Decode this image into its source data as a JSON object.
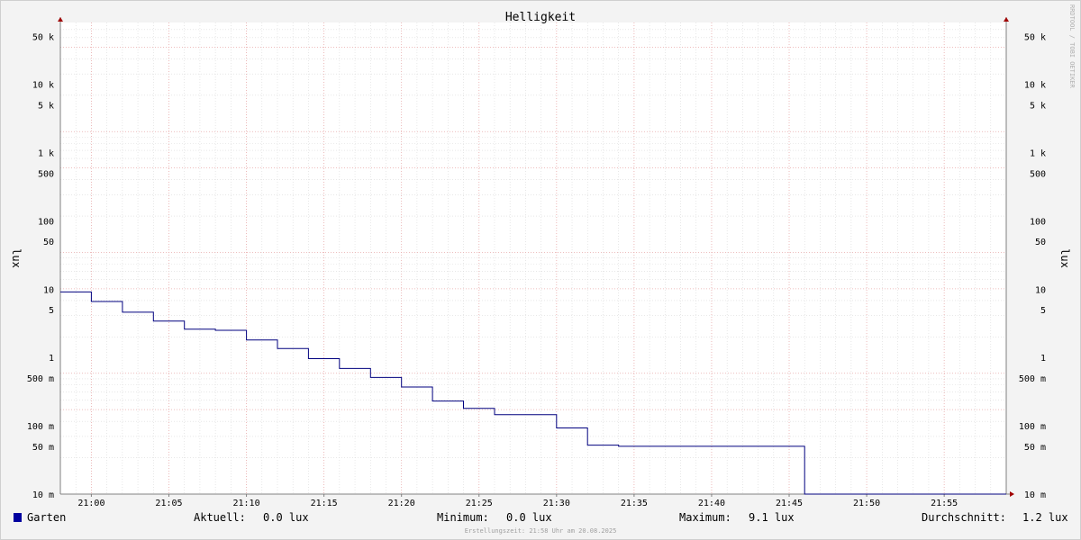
{
  "chart_data": {
    "type": "line",
    "title": "Helligkeit",
    "ylabel": "lux",
    "yscale": "log",
    "ylim": [
      10,
      80000
    ],
    "xlim": [
      "20:58",
      "21:59"
    ],
    "grid": true,
    "x_ticks": [
      "21:00",
      "21:05",
      "21:10",
      "21:15",
      "21:20",
      "21:25",
      "21:30",
      "21:35",
      "21:40",
      "21:45",
      "21:50",
      "21:55"
    ],
    "y_ticks": [
      {
        "value": 10,
        "label": "10 m"
      },
      {
        "value": 50,
        "label": "50 m"
      },
      {
        "value": 100,
        "label": "100 m"
      },
      {
        "value": 500,
        "label": "500 m"
      },
      {
        "value": 1000,
        "label": "1"
      },
      {
        "value": 5000,
        "label": "5"
      },
      {
        "value": 10000,
        "label": "10"
      },
      {
        "value": 50000,
        "label": "50"
      },
      {
        "value": 100000,
        "label": "100"
      },
      {
        "value": 500000,
        "label": "500"
      },
      {
        "value": 1000000,
        "label": "1 k"
      },
      {
        "value": 5000000,
        "label": "5 k"
      },
      {
        "value": 10000000,
        "label": "10 k"
      },
      {
        "value": 50000000,
        "label": "50 k"
      }
    ],
    "y_unit_note": "values in milli-lux",
    "series": [
      {
        "name": "Garten",
        "color": "#00007f",
        "points": [
          [
            "20:58",
            9100
          ],
          [
            "21:00",
            9100
          ],
          [
            "21:00",
            6600
          ],
          [
            "21:02",
            6600
          ],
          [
            "21:02",
            4600
          ],
          [
            "21:04",
            4600
          ],
          [
            "21:04",
            3400
          ],
          [
            "21:06",
            3400
          ],
          [
            "21:06",
            2600
          ],
          [
            "21:08",
            2600
          ],
          [
            "21:08",
            2500
          ],
          [
            "21:10",
            2500
          ],
          [
            "21:10",
            1800
          ],
          [
            "21:12",
            1800
          ],
          [
            "21:12",
            1350
          ],
          [
            "21:14",
            1350
          ],
          [
            "21:14",
            960
          ],
          [
            "21:16",
            960
          ],
          [
            "21:16",
            690
          ],
          [
            "21:18",
            690
          ],
          [
            "21:18",
            510
          ],
          [
            "21:20",
            510
          ],
          [
            "21:20",
            370
          ],
          [
            "21:22",
            370
          ],
          [
            "21:22",
            230
          ],
          [
            "21:24",
            230
          ],
          [
            "21:24",
            180
          ],
          [
            "21:26",
            180
          ],
          [
            "21:26",
            145
          ],
          [
            "21:30",
            145
          ],
          [
            "21:30",
            93
          ],
          [
            "21:32",
            93
          ],
          [
            "21:32",
            52
          ],
          [
            "21:34",
            52
          ],
          [
            "21:34",
            50
          ],
          [
            "21:46",
            50
          ],
          [
            "21:46",
            10
          ],
          [
            "21:59",
            10
          ]
        ]
      }
    ]
  },
  "watermark": "RRDTOOL / TOBI OETIKER",
  "legend": {
    "series_name": "Garten",
    "swatch_color": "#00009f",
    "current_label": "Aktuell:",
    "current_value": "0.0 lux",
    "min_label": "Minimum:",
    "min_value": "0.0 lux",
    "max_label": "Maximum:",
    "max_value": "9.1 lux",
    "avg_label": "Durchschnitt:",
    "avg_value": "1.2 lux"
  },
  "footer": "Erstellungszeit: 21:58 Uhr am 20.08.2025"
}
